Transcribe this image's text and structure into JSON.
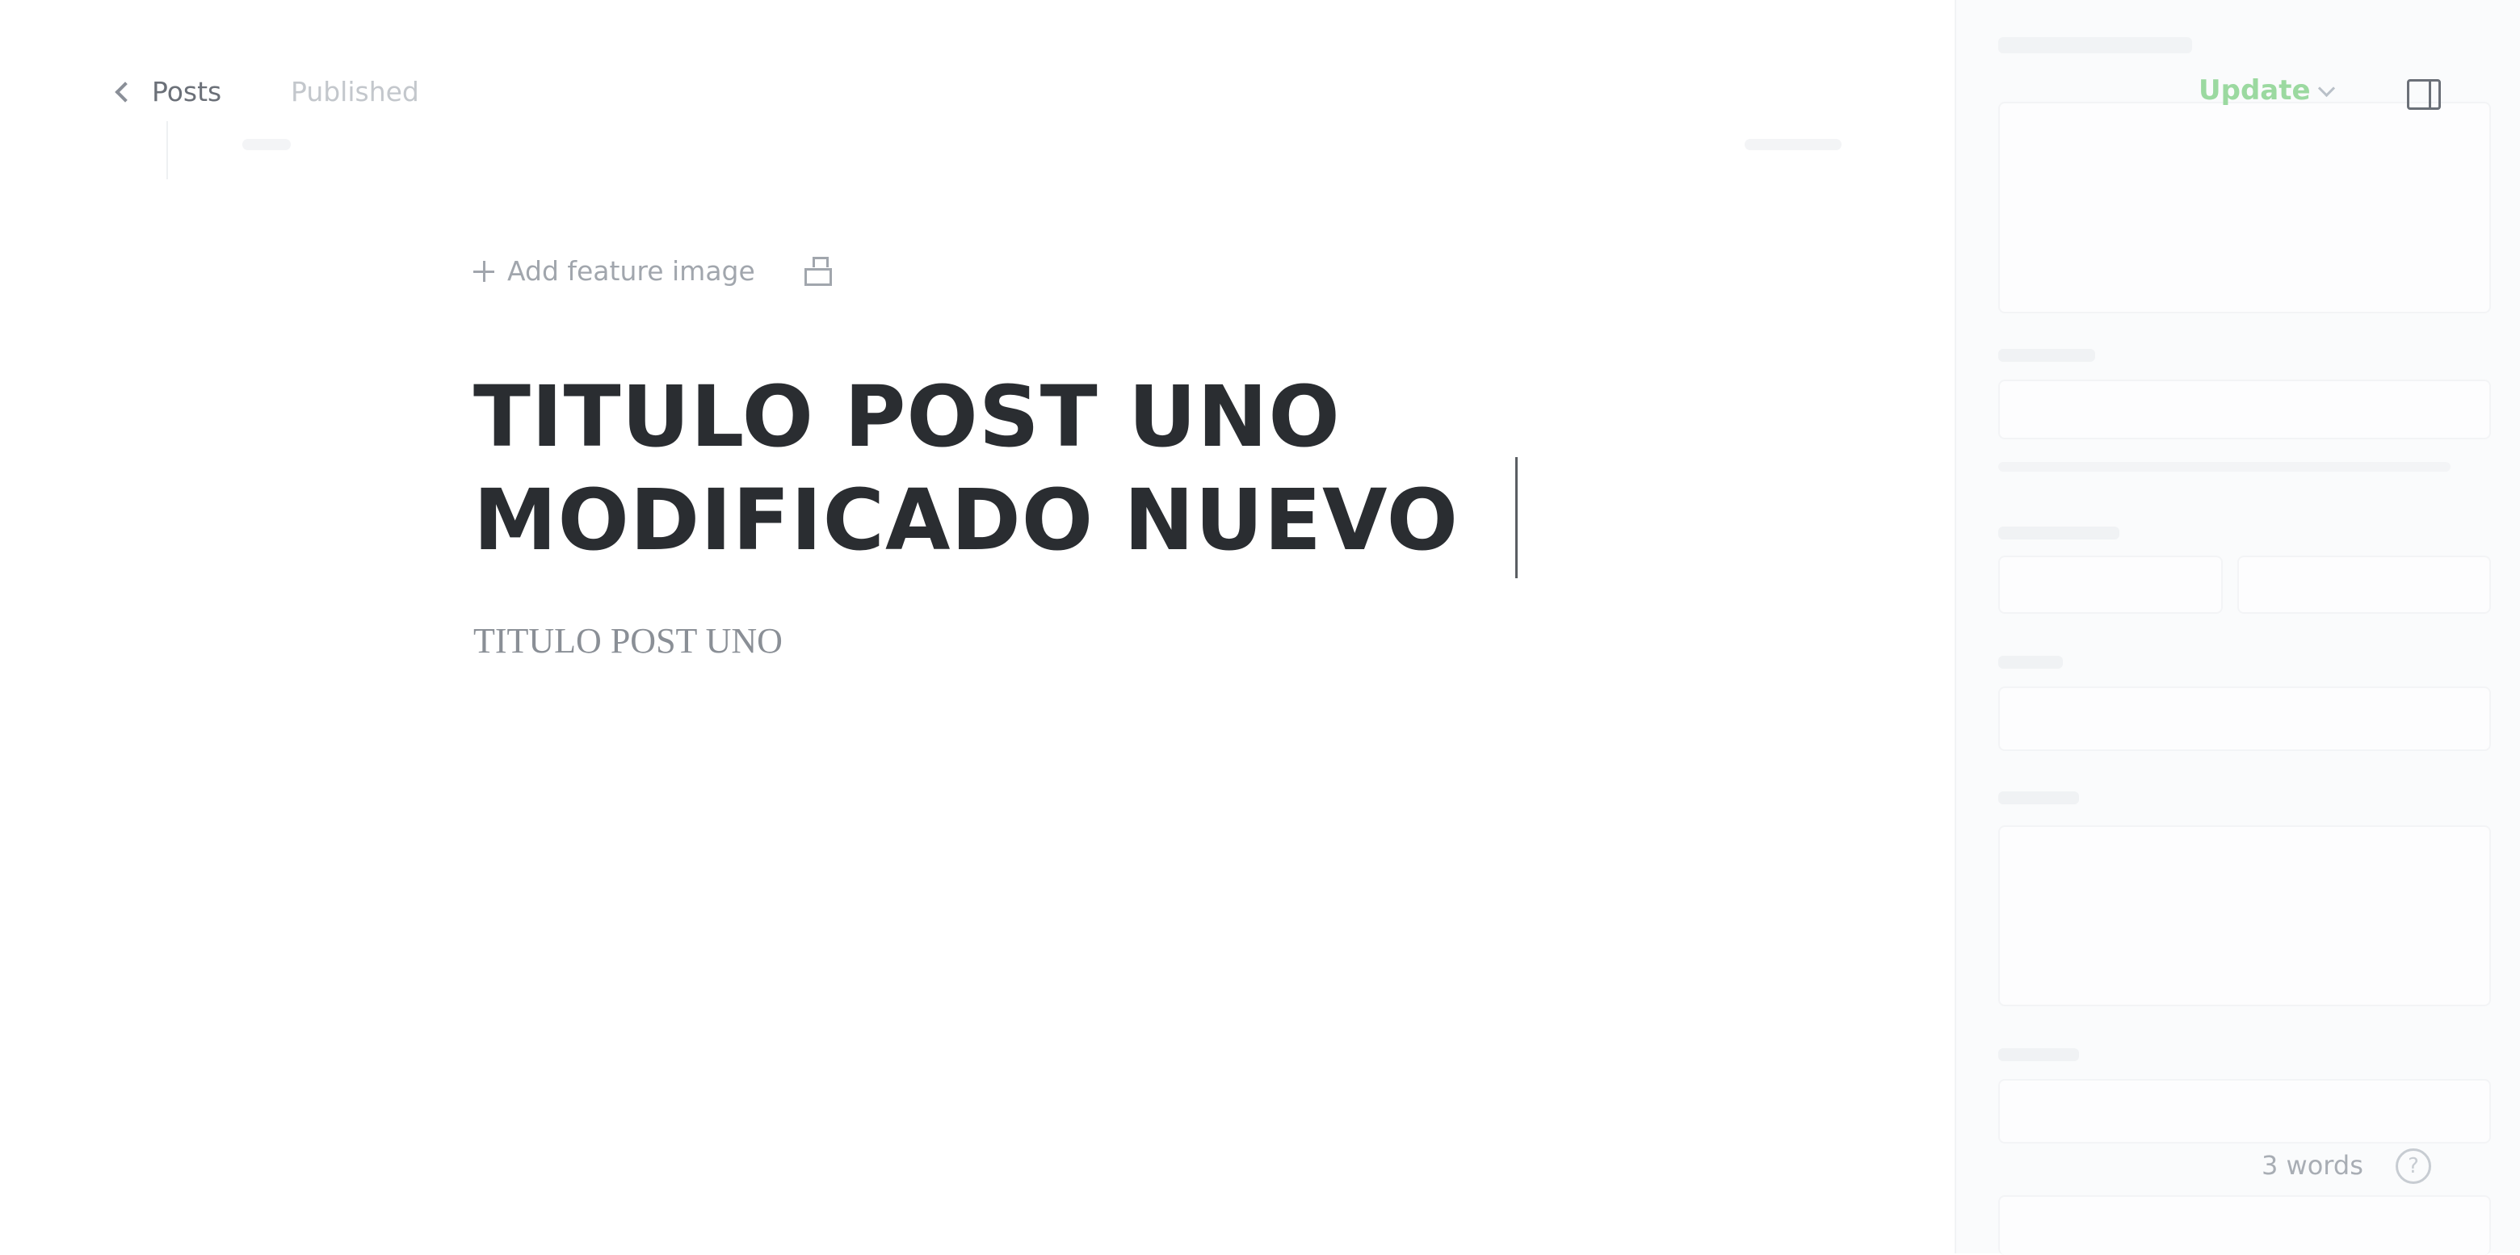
{
  "header": {
    "back_label": "Posts",
    "status": "Published",
    "update_label": "Update"
  },
  "editor": {
    "feature_image_label": "Add feature image",
    "title": "TITULO POST UNO MODIFICADO NUEVO",
    "excerpt": "TITULO POST UNO"
  },
  "footer": {
    "word_count": "3 words",
    "help_symbol": "?"
  },
  "colors": {
    "accent_green": "#9bd9a0",
    "sidebar_bg": "#fafbfc"
  },
  "icons": [
    "chevron-left-icon",
    "plus-icon",
    "unsplash-icon",
    "chevron-down-icon",
    "sidebar-toggle-icon",
    "help-icon"
  ]
}
